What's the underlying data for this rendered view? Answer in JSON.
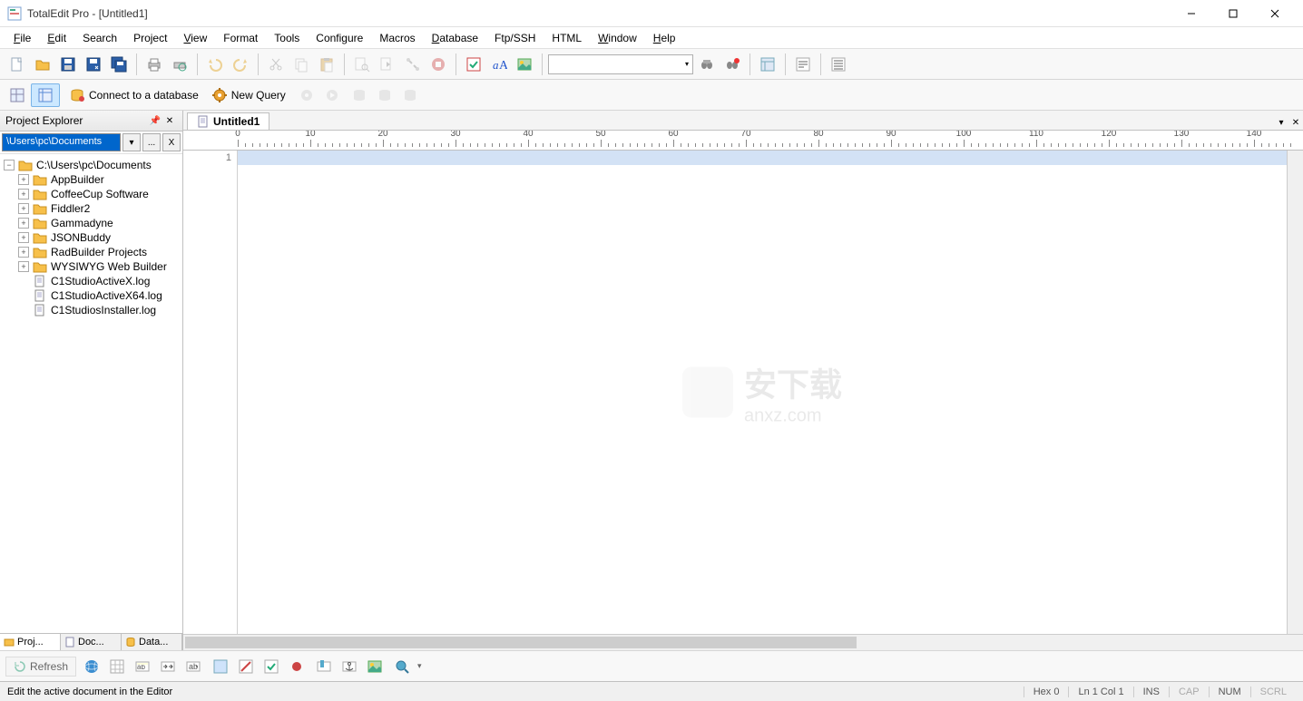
{
  "window": {
    "title": "TotalEdit Pro - [Untitled1]"
  },
  "menu": {
    "items": [
      "File",
      "Edit",
      "Search",
      "Project",
      "View",
      "Format",
      "Tools",
      "Configure",
      "Macros",
      "Database",
      "Ftp/SSH",
      "HTML",
      "Window",
      "Help"
    ],
    "underline_idx": [
      0,
      0,
      null,
      null,
      0,
      null,
      null,
      null,
      null,
      0,
      null,
      null,
      0,
      0
    ]
  },
  "toolbar2": {
    "connect_label": "Connect to a database",
    "new_query_label": "New Query"
  },
  "sidebar": {
    "title": "Project Explorer",
    "path": "\\Users\\pc\\Documents",
    "browse_btn": "...",
    "close_btn": "X",
    "root": "C:\\Users\\pc\\Documents",
    "folders": [
      "AppBuilder",
      "CoffeeCup Software",
      "Fiddler2",
      "Gammadyne",
      "JSONBuddy",
      "RadBuilder Projects",
      "WYSIWYG Web Builder"
    ],
    "files": [
      "C1StudioActiveX.log",
      "C1StudioActiveX64.log",
      "C1StudiosInstaller.log"
    ],
    "tabs": [
      "Proj...",
      "Doc...",
      "Data..."
    ]
  },
  "editor": {
    "tab": "Untitled1",
    "line_number": "1",
    "ruler_ticks": [
      0,
      10,
      20,
      30,
      40,
      50,
      60,
      70,
      80,
      90,
      100,
      110,
      120,
      130,
      140
    ]
  },
  "bottom_toolbar": {
    "refresh": "Refresh"
  },
  "status": {
    "hint": "Edit the active document in the Editor",
    "hex": "Hex  0",
    "pos": "Ln  1 Col  1",
    "ins": "INS",
    "cap": "CAP",
    "num": "NUM",
    "scrl": "SCRL"
  },
  "watermark": {
    "text1": "安下载",
    "text2": "anxz.com"
  }
}
